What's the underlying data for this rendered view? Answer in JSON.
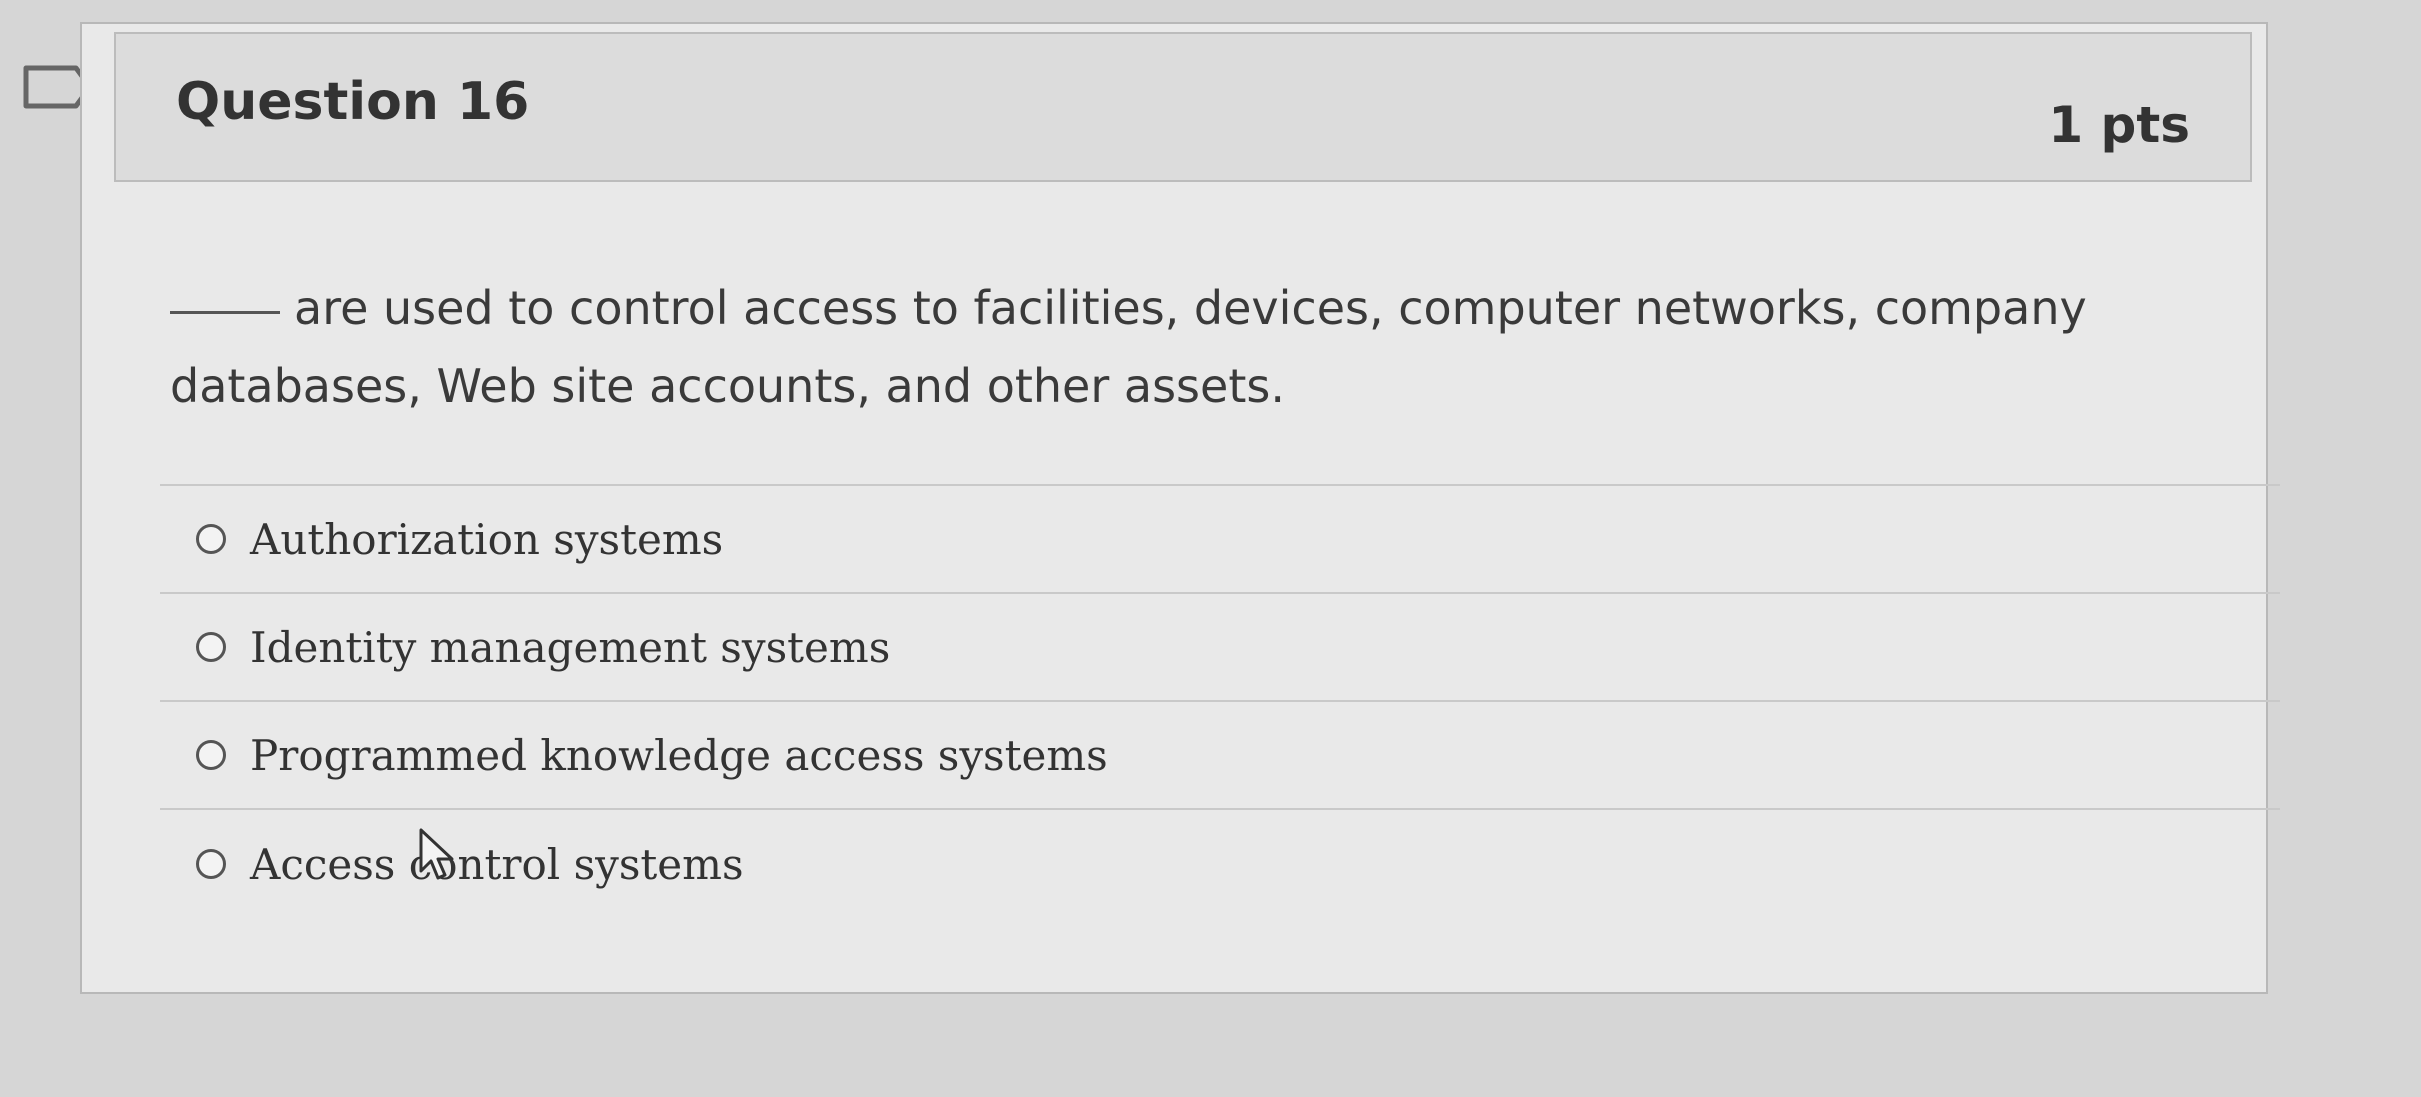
{
  "question": {
    "title": "Question 16",
    "points": "1 pts",
    "blank": "____",
    "stem": "are used to control access to facilities, devices, computer networks, company databases, Web site accounts, and other assets."
  },
  "answers": [
    {
      "label": "Authorization systems"
    },
    {
      "label": "Identity management systems"
    },
    {
      "label": "Programmed knowledge access systems"
    },
    {
      "label": "Access control systems"
    }
  ],
  "icons": {
    "bookmark": "bookmark-flag-icon",
    "cursor": "mouse-pointer-icon"
  }
}
